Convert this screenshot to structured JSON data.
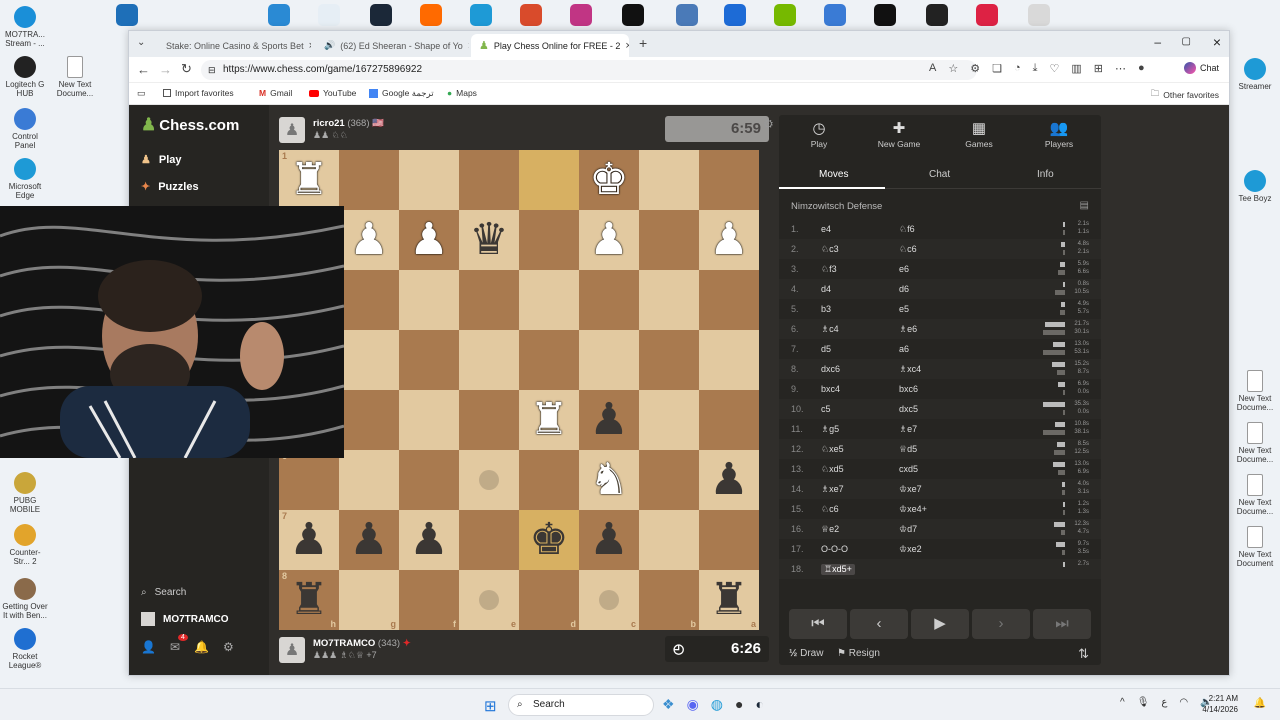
{
  "desktop": {
    "left_icons": [
      {
        "label": "MO7TRA... Stream - ...",
        "color": "#1a8fd8"
      },
      {
        "label": "Logitech G HUB",
        "color": "#222222"
      },
      {
        "label": "Control Panel",
        "color": "#3a7bd5"
      },
      {
        "label": "Microsoft Edge",
        "color": "#1e9ad6"
      },
      {
        "label": "PUBG MOBILE",
        "color": "#c9a63a"
      },
      {
        "label": "Counter-Str... 2",
        "color": "#e2a42b"
      },
      {
        "label": "Getting Over It with Ben...",
        "color": "#8a6a4a"
      },
      {
        "label": "Rocket League®",
        "color": "#1f6fd1"
      }
    ],
    "second_col_icons": [
      {
        "label": "New Text Docume..."
      }
    ],
    "right_icons": [
      {
        "label": "Streamer"
      },
      {
        "label": "Tee Boyz"
      },
      {
        "label": "New Text Docume..."
      },
      {
        "label": "New Text Docume..."
      },
      {
        "label": "New Text Docume..."
      },
      {
        "label": "New Text Document"
      }
    ]
  },
  "browser": {
    "tabs": [
      {
        "label": "Stake: Online Casino & Sports Bet"
      },
      {
        "label": "(62) Ed Sheeran - Shape of Yo"
      },
      {
        "label": "Play Chess Online for FREE - 2"
      }
    ],
    "url": "https://www.chess.com/game/167275896922",
    "chat_label": "Chat",
    "favorites": [
      {
        "label": "Import favorites",
        "color": "#555555"
      },
      {
        "label": "Gmail",
        "color": "#d93025"
      },
      {
        "label": "YouTube",
        "color": "#ff0000"
      },
      {
        "label": "Google ترجمة",
        "color": "#4285f4"
      },
      {
        "label": "Maps",
        "color": "#34a853"
      }
    ],
    "other_favorites": "Other favorites"
  },
  "sidebar": {
    "logo_text": "Chess.com",
    "items": [
      {
        "label": "Play"
      },
      {
        "label": "Puzzles"
      }
    ],
    "search_label": "Search",
    "user_label": "MO7TRAMCO",
    "notification_count": "4"
  },
  "opponent": {
    "name": "ricro21",
    "rating": "(368)",
    "clock": "6:59"
  },
  "player": {
    "name": "MO7TRAMCO",
    "rating": "(343)",
    "clock": "6:26",
    "captured_extra": "+7"
  },
  "board": {
    "files": [
      "h",
      "g",
      "f",
      "e",
      "d",
      "c",
      "b",
      "a"
    ],
    "ranks": [
      "1",
      "2",
      "3",
      "4",
      "5",
      "6",
      "7",
      "8"
    ],
    "squares": [
      [
        "wr",
        "",
        "",
        "",
        "",
        "wk",
        "",
        ""
      ],
      [
        "",
        "wp",
        "wp",
        "bq",
        "",
        "wp",
        "",
        "wp"
      ],
      [
        "",
        "",
        "",
        "",
        "",
        "",
        "",
        ""
      ],
      [
        "",
        "",
        "",
        "",
        "",
        "",
        "",
        ""
      ],
      [
        "",
        "",
        "",
        "",
        "wr",
        "bp",
        "",
        ""
      ],
      [
        "",
        "",
        "",
        "dot",
        "",
        "wn",
        "",
        "bp"
      ],
      [
        "bp",
        "bp",
        "bp",
        "",
        "bk",
        "bp",
        "",
        ""
      ],
      [
        "br",
        "",
        "",
        "dot",
        "",
        "dot",
        "",
        "br"
      ]
    ],
    "highlights": [
      "0-4",
      "6-4"
    ]
  },
  "panel": {
    "top_tabs": [
      {
        "label": "Play",
        "icon": "◷"
      },
      {
        "label": "New Game",
        "icon": "✚"
      },
      {
        "label": "Games",
        "icon": "▦"
      },
      {
        "label": "Players",
        "icon": "👥"
      }
    ],
    "sub_tabs": [
      {
        "label": "Moves"
      },
      {
        "label": "Chat"
      },
      {
        "label": "Info"
      }
    ],
    "opening": "Nimzowitsch Defense",
    "moves": [
      {
        "n": "1.",
        "w": "e4",
        "b": "♘f6",
        "tw": "2.1s",
        "tb": "1.1s",
        "fw": 0.1,
        "fb": 0.05
      },
      {
        "n": "2.",
        "w": "♘c3",
        "b": "♘c6",
        "tw": "4.8s",
        "tb": "2.1s",
        "fw": 0.2,
        "fb": 0.1
      },
      {
        "n": "3.",
        "w": "♘f3",
        "b": "e6",
        "tw": "5.9s",
        "tb": "6.6s",
        "fw": 0.25,
        "fb": 0.3
      },
      {
        "n": "4.",
        "w": "d4",
        "b": "d6",
        "tw": "0.8s",
        "tb": "10.5s",
        "fw": 0.05,
        "fb": 0.45
      },
      {
        "n": "5.",
        "w": "b3",
        "b": "e5",
        "tw": "4.9s",
        "tb": "5.7s",
        "fw": 0.2,
        "fb": 0.25
      },
      {
        "n": "6.",
        "w": "♗c4",
        "b": "♗e6",
        "tw": "21.7s",
        "tb": "30.1s",
        "fw": 0.9,
        "fb": 1.0
      },
      {
        "n": "7.",
        "w": "d5",
        "b": "a6",
        "tw": "13.0s",
        "tb": "53.1s",
        "fw": 0.55,
        "fb": 1.0
      },
      {
        "n": "8.",
        "w": "dxc6",
        "b": "♗xc4",
        "tw": "15.2s",
        "tb": "8.7s",
        "fw": 0.6,
        "fb": 0.35
      },
      {
        "n": "9.",
        "w": "bxc4",
        "b": "bxc6",
        "tw": "6.9s",
        "tb": "0.0s",
        "fw": 0.3,
        "fb": 0.02
      },
      {
        "n": "10.",
        "w": "c5",
        "b": "dxc5",
        "tw": "35.3s",
        "tb": "0.0s",
        "fw": 1.0,
        "fb": 0.02
      },
      {
        "n": "11.",
        "w": "♗g5",
        "b": "♗e7",
        "tw": "10.8s",
        "tb": "38.1s",
        "fw": 0.45,
        "fb": 1.0
      },
      {
        "n": "12.",
        "w": "♘xe5",
        "b": "♕d5",
        "tw": "8.5s",
        "tb": "12.5s",
        "fw": 0.35,
        "fb": 0.5
      },
      {
        "n": "13.",
        "w": "♘xd5",
        "b": "cxd5",
        "tw": "13.0s",
        "tb": "6.9s",
        "fw": 0.55,
        "fb": 0.3
      },
      {
        "n": "14.",
        "w": "♗xe7",
        "b": "♔xe7",
        "tw": "4.0s",
        "tb": "3.1s",
        "fw": 0.15,
        "fb": 0.12
      },
      {
        "n": "15.",
        "w": "♘c6",
        "b": "♔xe4+",
        "tw": "1.2s",
        "tb": "1.3s",
        "fw": 0.05,
        "fb": 0.05
      },
      {
        "n": "16.",
        "w": "♕e2",
        "b": "♔d7",
        "tw": "12.3s",
        "tb": "4.7s",
        "fw": 0.5,
        "fb": 0.2
      },
      {
        "n": "17.",
        "w": "O-O-O",
        "b": "♔xe2",
        "tw": "9.7s",
        "tb": "3.5s",
        "fw": 0.4,
        "fb": 0.15
      },
      {
        "n": "18.",
        "w": "♖xd5+",
        "b": "",
        "tw": "2.7s",
        "tb": "",
        "fw": 0.1,
        "fb": 0
      }
    ],
    "draw_label": "Draw",
    "resign_label": "Resign"
  },
  "taskbar": {
    "search_label": "Search",
    "time": "2:21 AM",
    "date": "4/14/2026"
  }
}
